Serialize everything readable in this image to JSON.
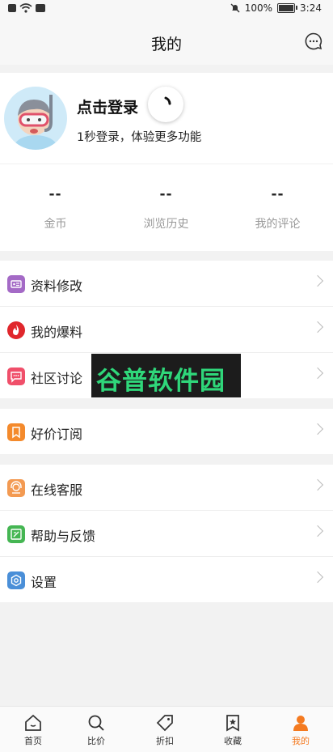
{
  "status_bar": {
    "battery": "100%",
    "time": "3:24"
  },
  "header": {
    "title": "我的",
    "message_icon": "message-icon"
  },
  "profile": {
    "login_title": "点击登录",
    "login_subtitle": "1秒登录，体验更多功能",
    "stats": [
      {
        "value": "--",
        "label": "金币"
      },
      {
        "value": "--",
        "label": "浏览历史"
      },
      {
        "value": "--",
        "label": "我的评论"
      }
    ]
  },
  "menu_groups": [
    [
      {
        "label": "资料修改",
        "icon": "id-card-icon",
        "color": "#a46ac6"
      },
      {
        "label": "我的爆料",
        "icon": "flame-icon",
        "color": "#e0272c"
      },
      {
        "label": "社区讨论",
        "icon": "chat-icon",
        "color": "#f04f6a"
      }
    ],
    [
      {
        "label": "好价订阅",
        "icon": "bookmark-icon",
        "color": "#f48a2c"
      }
    ],
    [
      {
        "label": "在线客服",
        "icon": "support-icon",
        "color": "#f39a52"
      },
      {
        "label": "帮助与反馈",
        "icon": "edit-icon",
        "color": "#45b653"
      },
      {
        "label": "设置",
        "icon": "settings-icon",
        "color": "#4a8fd8"
      }
    ]
  ],
  "watermark": "谷普软件园",
  "tabs": [
    {
      "label": "首页",
      "icon": "home-icon"
    },
    {
      "label": "比价",
      "icon": "search-icon"
    },
    {
      "label": "折扣",
      "icon": "tag-icon"
    },
    {
      "label": "收藏",
      "icon": "star-bookmark-icon"
    },
    {
      "label": "我的",
      "icon": "user-icon",
      "active": true
    }
  ],
  "colors": {
    "accent": "#f47a20"
  }
}
